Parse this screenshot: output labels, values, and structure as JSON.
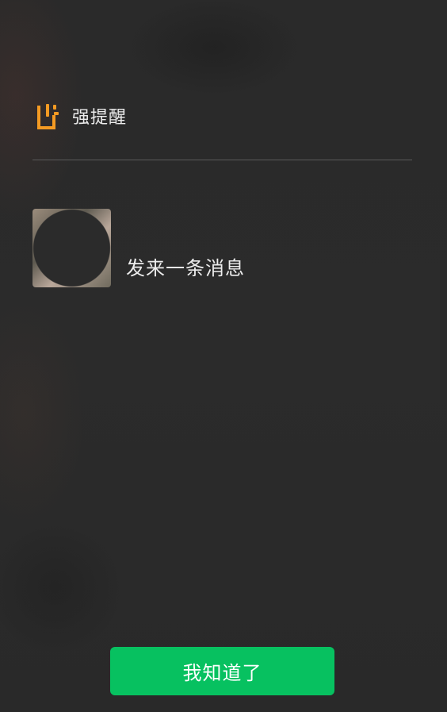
{
  "header": {
    "icon": "strong-reminder-icon",
    "title": "强提醒"
  },
  "message": {
    "avatar": "avatar",
    "text": "发来一条消息"
  },
  "actions": {
    "confirm_label": "我知道了"
  },
  "colors": {
    "background": "#2c2c2c",
    "accent_orange": "#f59b23",
    "button_green": "#07c160",
    "divider": "#5a5a5a",
    "text": "#ececec"
  }
}
